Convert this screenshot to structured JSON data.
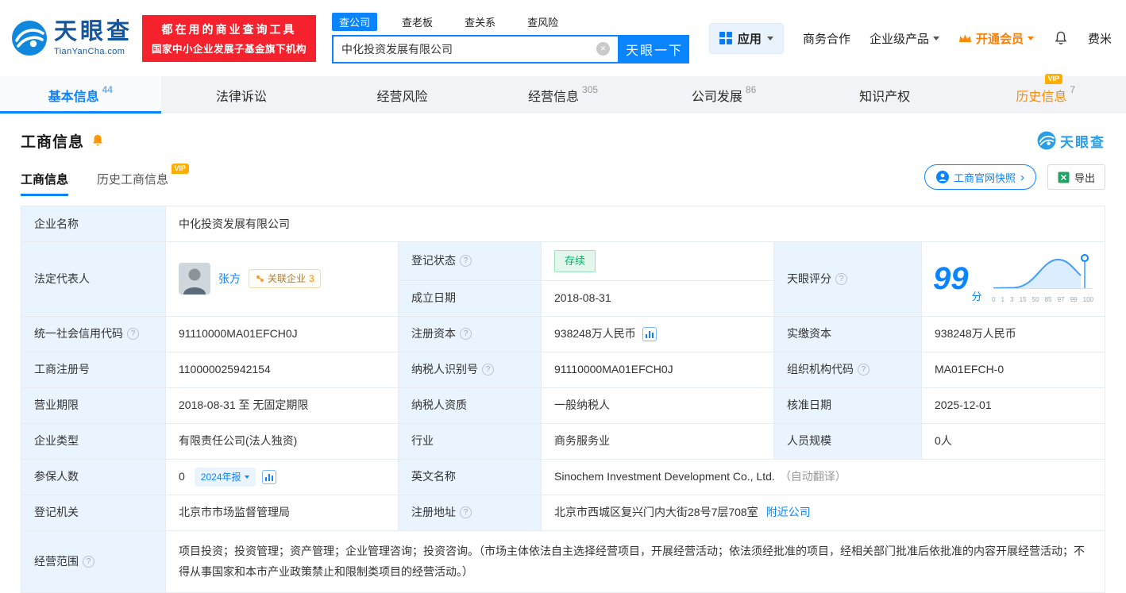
{
  "common": {
    "vip": "VIP"
  },
  "header": {
    "logo_text": "天眼查",
    "logo_domain": "TianYanCha.com",
    "slogan_line1": "都在用的商业查询工具",
    "slogan_line2": "国家中小企业发展子基金旗下机构",
    "search_tabs": [
      {
        "label": "查公司"
      },
      {
        "label": "查老板"
      },
      {
        "label": "查关系"
      },
      {
        "label": "查风险"
      }
    ],
    "search_value": "中化投资发展有限公司",
    "search_button": "天眼一下",
    "apps_label": "应用",
    "menu_biz": "商务合作",
    "menu_enterprise": "企业级产品",
    "menu_vip": "开通会员",
    "menu_user": "费米"
  },
  "nav": {
    "tabs": [
      {
        "label": "基本信息",
        "count": "44"
      },
      {
        "label": "法律诉讼",
        "count": ""
      },
      {
        "label": "经营风险",
        "count": ""
      },
      {
        "label": "经营信息",
        "count": "305"
      },
      {
        "label": "公司发展",
        "count": "86"
      },
      {
        "label": "知识产权",
        "count": ""
      },
      {
        "label": "历史信息",
        "count": "7"
      }
    ]
  },
  "section": {
    "title": "工商信息",
    "brand": "天眼查",
    "tab_current": "工商信息",
    "tab_history": "历史工商信息",
    "snapshot_button": "工商官网快照",
    "export_button": "导出"
  },
  "info": {
    "name_label": "企业名称",
    "name": "中化投资发展有限公司",
    "legal_label": "法定代表人",
    "legal_name": "张方",
    "related": "关联企业",
    "related_count": "3",
    "status_label": "登记状态",
    "status": "存续",
    "score_label": "天眼评分",
    "score": "99",
    "score_unit": "分",
    "score_ticks": [
      "0",
      "1",
      "3",
      "15",
      "50",
      "85",
      "97",
      "99",
      "100"
    ],
    "established_label": "成立日期",
    "established": "2018-08-31",
    "uscc_label": "统一社会信用代码",
    "uscc": "91110000MA01EFCH0J",
    "regcap_label": "注册资本",
    "regcap": "938248万人民币",
    "paidcap_label": "实缴资本",
    "paidcap": "938248万人民币",
    "regno_label": "工商注册号",
    "regno": "110000025942154",
    "taxid_label": "纳税人识别号",
    "taxid": "91110000MA01EFCH0J",
    "orgcode_label": "组织机构代码",
    "orgcode": "MA01EFCH-0",
    "term_label": "营业期限",
    "term": "2018-08-31 至 无固定期限",
    "taxq_label": "纳税人资质",
    "taxq": "一般纳税人",
    "approve_label": "核准日期",
    "approve": "2025-12-01",
    "type_label": "企业类型",
    "type": "有限责任公司(法人独资)",
    "industry_label": "行业",
    "industry": "商务服务业",
    "staff_label": "人员规模",
    "staff": "0人",
    "insured_label": "参保人数",
    "insured": "0",
    "annual_report": "2024年报",
    "en_label": "英文名称",
    "en_name": "Sinochem Investment Development Co., Ltd.",
    "en_note": "（自动翻译）",
    "registry_label": "登记机关",
    "registry": "北京市市场监督管理局",
    "address_label": "注册地址",
    "address": "北京市西城区复兴门内大街28号7层708室",
    "nearby": "附近公司",
    "scope_label": "经营范围",
    "scope": "项目投资；投资管理；资产管理；企业管理咨询；投资咨询。（市场主体依法自主选择经营项目，开展经营活动；依法须经批准的项目，经相关部门批准后依批准的内容开展经营活动；不得从事国家和本市产业政策禁止和限制类项目的经营活动。）"
  }
}
